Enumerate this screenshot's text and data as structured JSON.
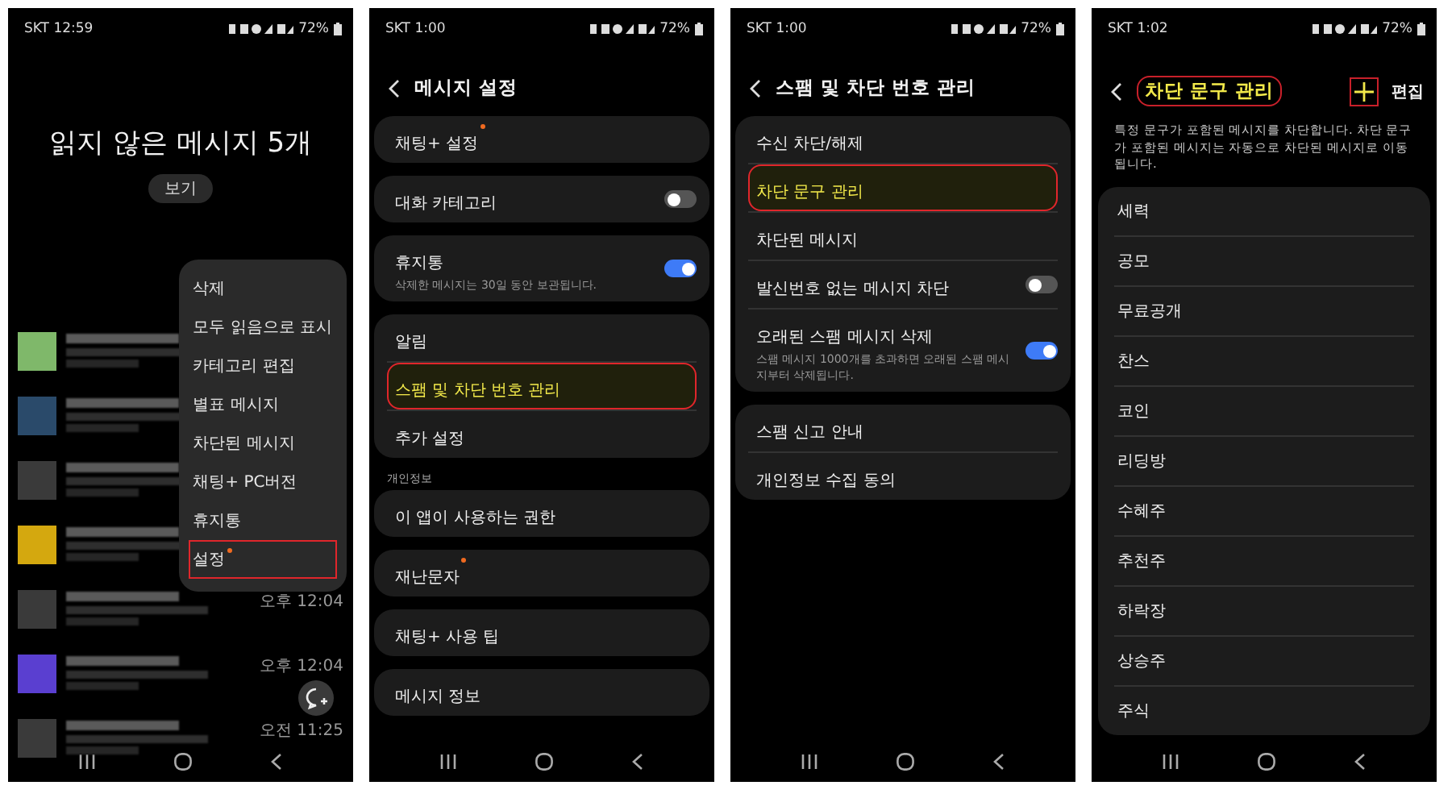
{
  "phones": [
    {
      "kind": "inbox",
      "status": {
        "carrier_time": "SKT 12:59",
        "battery": "72%"
      },
      "headline": "읽지 않은 메시지 5개",
      "view_button": "보기",
      "conversations": [
        {
          "color": "#7fb86a"
        },
        {
          "color": "#2a4a6a"
        },
        {
          "color": "#3a3a3a"
        },
        {
          "color": "#d4a80f"
        },
        {
          "color": "#3a3a3a",
          "time": "오후 12:04"
        },
        {
          "color": "#5a3fd0",
          "time": "오후 12:04"
        },
        {
          "color": "#3a3a3a",
          "time": "오전 11:25"
        }
      ],
      "menu": [
        {
          "label": "삭제",
          "highlighted": false,
          "new": false
        },
        {
          "label": "모두 읽음으로 표시",
          "highlighted": false,
          "new": false
        },
        {
          "label": "카테고리 편집",
          "highlighted": false,
          "new": false
        },
        {
          "label": "별표 메시지",
          "highlighted": false,
          "new": false
        },
        {
          "label": "차단된 메시지",
          "highlighted": false,
          "new": false
        },
        {
          "label": "채팅+ PC버전",
          "highlighted": false,
          "new": false
        },
        {
          "label": "휴지통",
          "highlighted": false,
          "new": false
        },
        {
          "label": "설정",
          "highlighted": true,
          "new": true
        }
      ]
    },
    {
      "kind": "settings",
      "status": {
        "carrier_time": "SKT 1:00",
        "battery": "72%"
      },
      "title": "메시지 설정",
      "sections": [
        {
          "items": [
            {
              "kind": "link",
              "label": "채팅+ 설정",
              "new": true,
              "highlighted": false
            }
          ]
        },
        {
          "items": [
            {
              "kind": "toggle",
              "label": "대화 카테고리",
              "on": false,
              "new": false,
              "highlighted": false
            }
          ]
        },
        {
          "items": [
            {
              "kind": "toggle",
              "label": "휴지통",
              "subtitle": "삭제한 메시지는 30일 동안 보관됩니다.",
              "on": true,
              "new": false,
              "highlighted": false
            }
          ]
        },
        {
          "items": [
            {
              "kind": "link",
              "label": "알림",
              "new": false,
              "highlighted": false
            },
            {
              "kind": "link",
              "label": "스팸 및 차단 번호 관리",
              "new": false,
              "highlighted": true
            },
            {
              "kind": "link",
              "label": "추가 설정",
              "new": false,
              "highlighted": false
            }
          ]
        },
        {
          "header": "개인정보",
          "items": [
            {
              "kind": "link",
              "label": "이 앱이 사용하는 권한",
              "new": false,
              "highlighted": false
            }
          ]
        },
        {
          "items": [
            {
              "kind": "link",
              "label": "재난문자",
              "new": true,
              "highlighted": false
            }
          ]
        },
        {
          "items": [
            {
              "kind": "link",
              "label": "채팅+ 사용 팁",
              "new": false,
              "highlighted": false
            }
          ]
        },
        {
          "items": [
            {
              "kind": "link",
              "label": "메시지 정보",
              "new": false,
              "highlighted": false
            }
          ]
        }
      ]
    },
    {
      "kind": "settings",
      "status": {
        "carrier_time": "SKT 1:00",
        "battery": "72%"
      },
      "title": "스팸 및 차단 번호 관리",
      "sections": [
        {
          "items": [
            {
              "kind": "link",
              "label": "수신 차단/해제",
              "new": false,
              "highlighted": false
            },
            {
              "kind": "link",
              "label": "차단 문구 관리",
              "new": false,
              "highlighted": true
            },
            {
              "kind": "link",
              "label": "차단된 메시지",
              "new": false,
              "highlighted": false
            },
            {
              "kind": "toggle",
              "label": "발신번호 없는 메시지 차단",
              "on": false,
              "new": false,
              "highlighted": false
            },
            {
              "kind": "toggle",
              "label": "오래된 스팸 메시지 삭제",
              "subtitle": "스팸 메시지 1000개를 초과하면 오래된 스팸 메시지부터 삭제됩니다.",
              "on": true,
              "new": false,
              "highlighted": false
            }
          ]
        },
        {
          "items": [
            {
              "kind": "link",
              "label": "스팸 신고 안내",
              "new": false,
              "highlighted": false
            },
            {
              "kind": "link",
              "label": "개인정보 수집 동의",
              "new": false,
              "highlighted": false
            }
          ]
        }
      ]
    },
    {
      "kind": "phrases",
      "status": {
        "carrier_time": "SKT 1:02",
        "battery": "72%"
      },
      "title": "차단 문구 관리",
      "title_highlighted": true,
      "add_highlighted": true,
      "edit_button": "편집",
      "description": "특정 문구가 포함된 메시지를 차단합니다. 차단 문구가 포함된 메시지는 자동으로 차단된 메시지로 이동됩니다.",
      "phrases": [
        "세력",
        "공모",
        "무료공개",
        "찬스",
        "코인",
        "리딩방",
        "수혜주",
        "추천주",
        "하락장",
        "상승주",
        "주식"
      ]
    }
  ]
}
